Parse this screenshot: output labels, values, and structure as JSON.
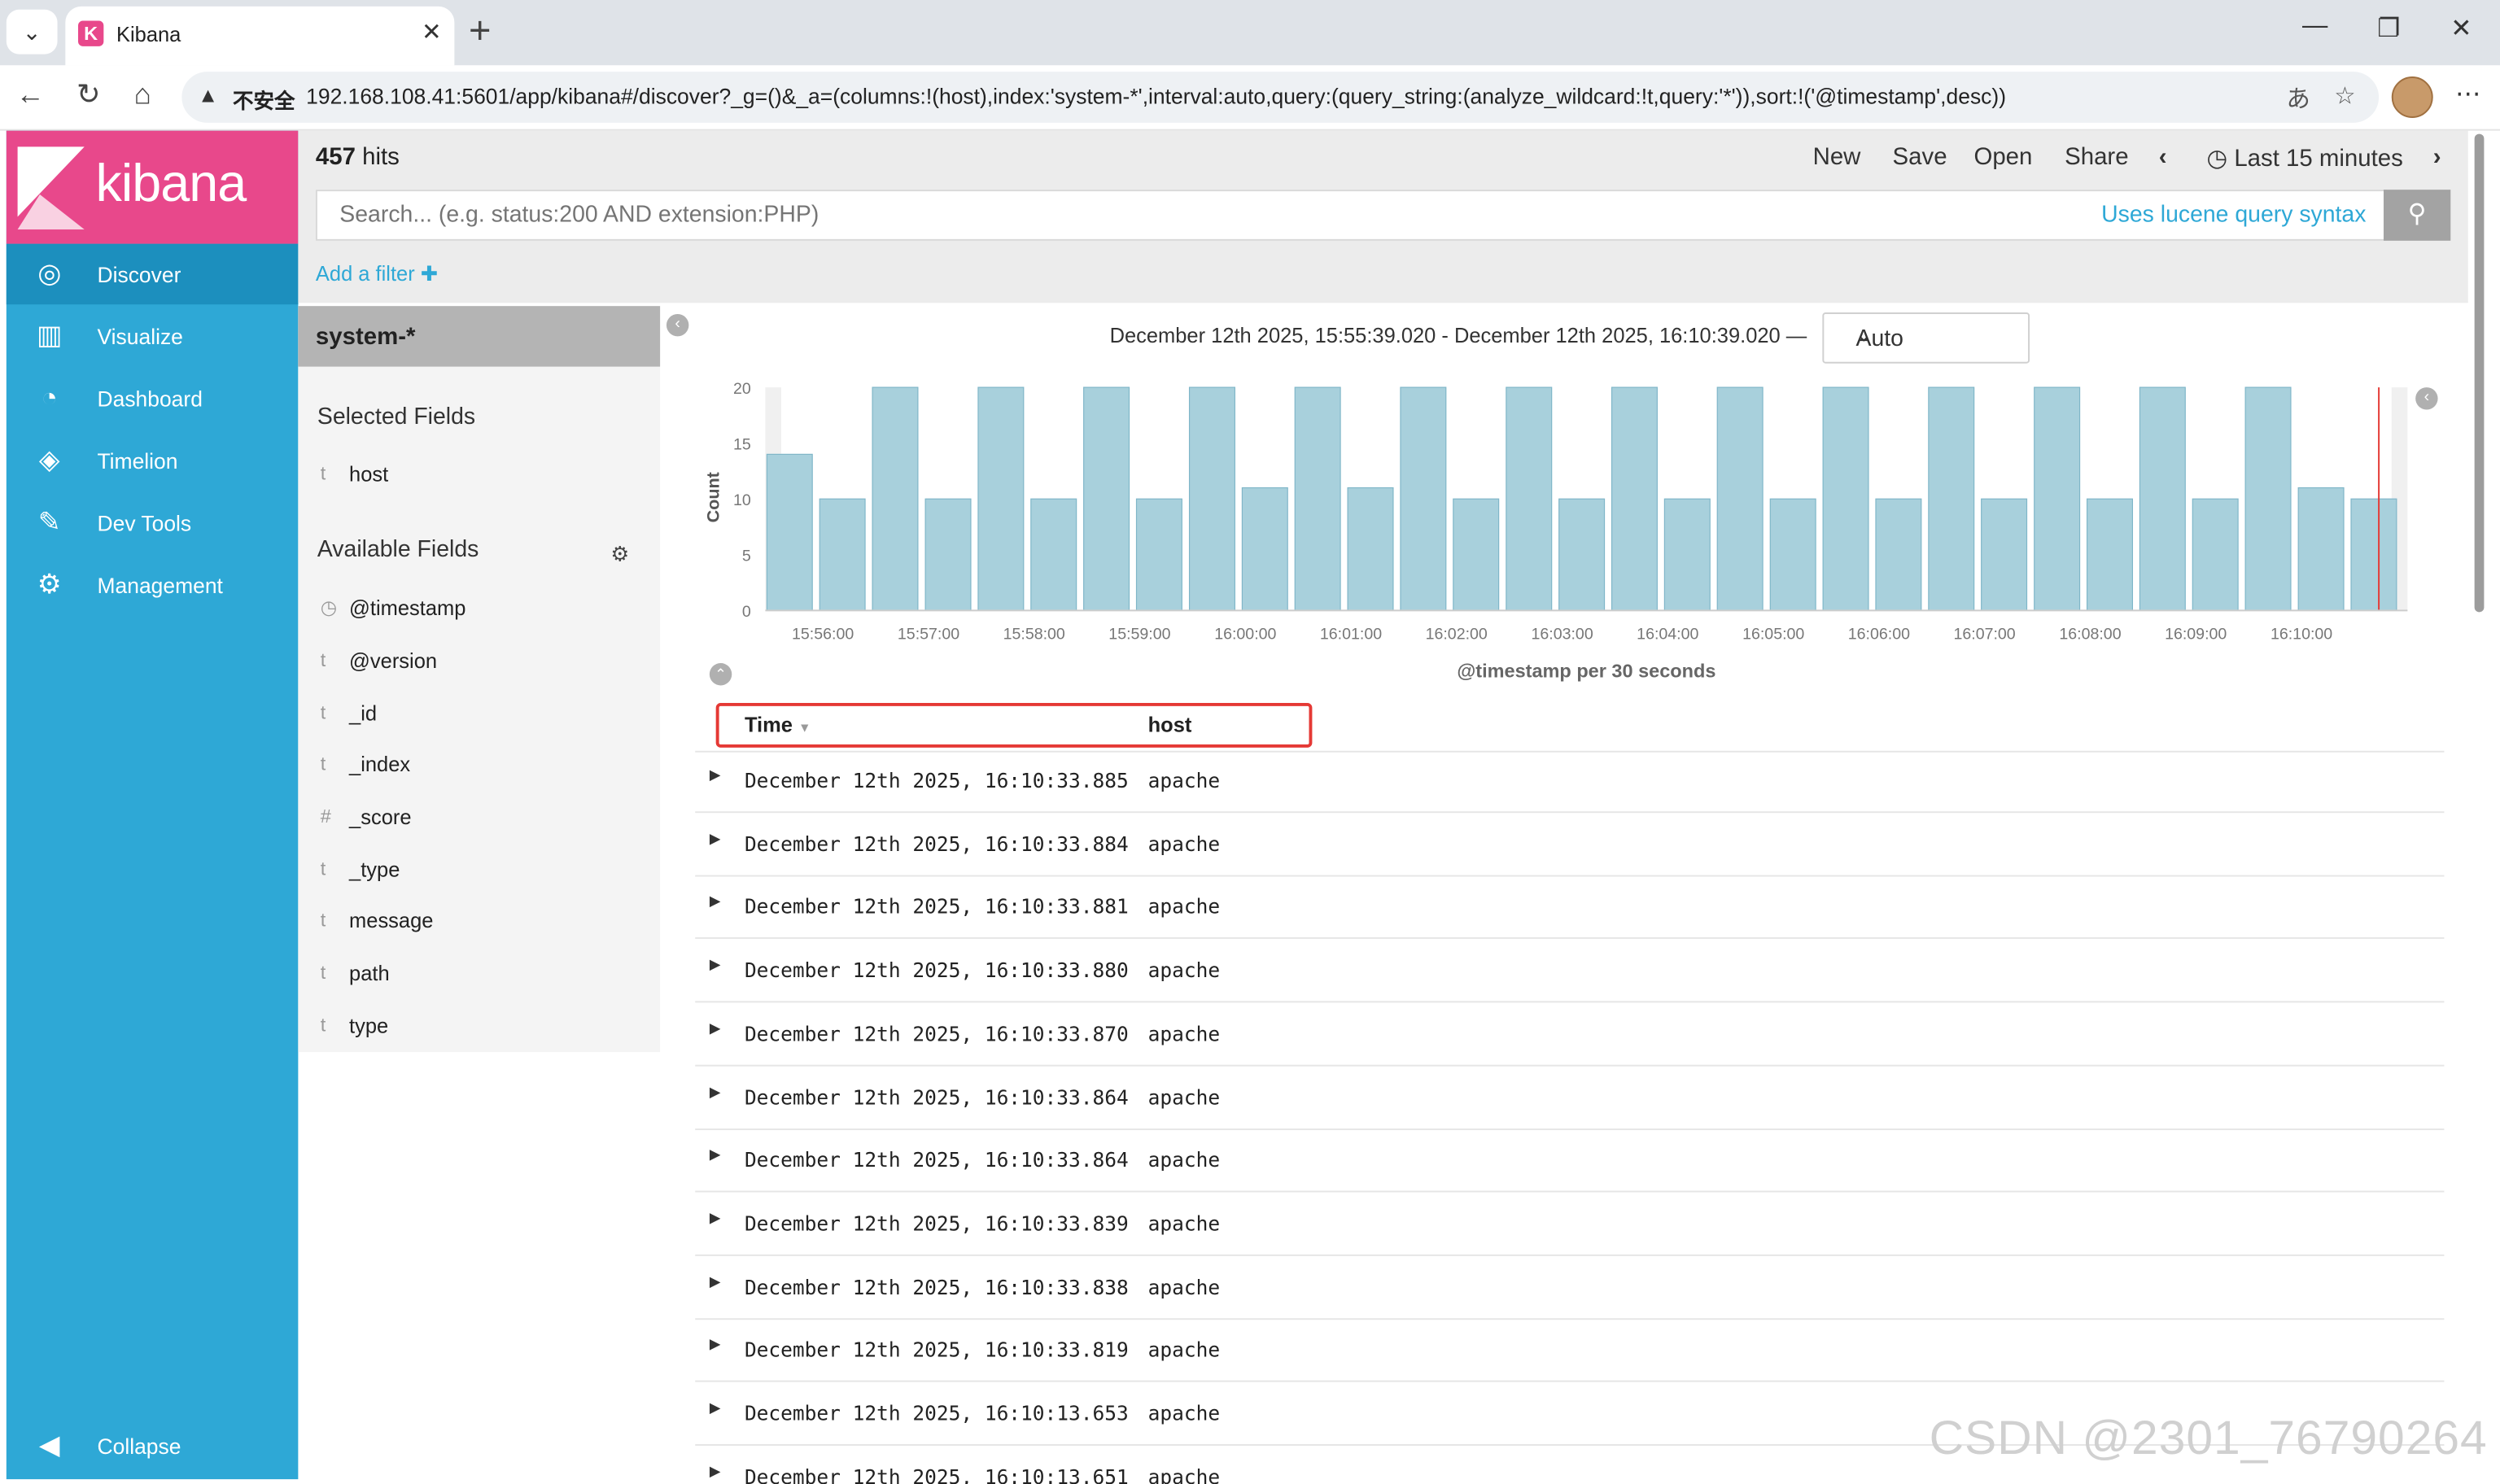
{
  "browser": {
    "tab_title": "Kibana",
    "favicon_letter": "K",
    "security_label": "不安全",
    "url": "192.168.108.41:5601/app/kibana#/discover?_g=()&_a=(columns:!(host),index:'system-*',interval:auto,query:(query_string:(analyze_wildcard:!t,query:'*')),sort:!('@timestamp',desc))"
  },
  "sidebar": {
    "logo_text": "kibana",
    "items": [
      {
        "label": "Discover",
        "icon": "compass-icon",
        "glyph": "◎"
      },
      {
        "label": "Visualize",
        "icon": "bar-chart-icon",
        "glyph": "▥"
      },
      {
        "label": "Dashboard",
        "icon": "gauge-icon",
        "glyph": "◔"
      },
      {
        "label": "Timelion",
        "icon": "timelion-icon",
        "glyph": "◈"
      },
      {
        "label": "Dev Tools",
        "icon": "wrench-icon",
        "glyph": "✎"
      },
      {
        "label": "Management",
        "icon": "gear-icon",
        "glyph": "⚙"
      }
    ],
    "collapse_label": "Collapse"
  },
  "topbar": {
    "hits_count": "457",
    "hits_suffix": "hits",
    "menu": [
      "New",
      "Save",
      "Open",
      "Share"
    ],
    "time_label": "Last 15 minutes",
    "search_placeholder": "Search... (e.g. status:200 AND extension:PHP)",
    "lucene_label": "Uses lucene query syntax",
    "add_filter_label": "Add a filter"
  },
  "fields_panel": {
    "index_pattern": "system-*",
    "selected_title": "Selected Fields",
    "selected_fields": [
      {
        "type": "t",
        "name": "host"
      }
    ],
    "available_title": "Available Fields",
    "available_fields": [
      {
        "type": "◷",
        "name": "@timestamp"
      },
      {
        "type": "t",
        "name": "@version"
      },
      {
        "type": "t",
        "name": "_id"
      },
      {
        "type": "t",
        "name": "_index"
      },
      {
        "type": "#",
        "name": "_score"
      },
      {
        "type": "t",
        "name": "_type"
      },
      {
        "type": "t",
        "name": "message"
      },
      {
        "type": "t",
        "name": "path"
      },
      {
        "type": "t",
        "name": "type"
      }
    ]
  },
  "histogram": {
    "range_text": "December 12th 2025, 15:55:39.020 - December 12th 2025, 16:10:39.020 —",
    "interval_value": "Auto"
  },
  "chart_data": {
    "type": "bar",
    "ylabel": "Count",
    "xlabel": "@timestamp per 30 seconds",
    "ylim": [
      0,
      20
    ],
    "yticks": [
      0,
      5,
      10,
      15,
      20
    ],
    "xticks": [
      "15:56:00",
      "15:57:00",
      "15:58:00",
      "15:59:00",
      "16:00:00",
      "16:01:00",
      "16:02:00",
      "16:03:00",
      "16:04:00",
      "16:05:00",
      "16:06:00",
      "16:07:00",
      "16:08:00",
      "16:09:00",
      "16:10:00"
    ],
    "values": [
      14,
      10,
      20,
      10,
      20,
      10,
      20,
      10,
      20,
      11,
      20,
      11,
      20,
      10,
      20,
      10,
      20,
      10,
      20,
      10,
      20,
      10,
      20,
      10,
      20,
      10,
      20,
      10,
      20,
      11,
      10
    ],
    "bar_color": "#a8d0dc",
    "grid": false
  },
  "table": {
    "col_time": "Time",
    "col_host": "host",
    "rows": [
      {
        "time": "December 12th 2025, 16:10:33.885",
        "host": "apache"
      },
      {
        "time": "December 12th 2025, 16:10:33.884",
        "host": "apache"
      },
      {
        "time": "December 12th 2025, 16:10:33.881",
        "host": "apache"
      },
      {
        "time": "December 12th 2025, 16:10:33.880",
        "host": "apache"
      },
      {
        "time": "December 12th 2025, 16:10:33.870",
        "host": "apache"
      },
      {
        "time": "December 12th 2025, 16:10:33.864",
        "host": "apache"
      },
      {
        "time": "December 12th 2025, 16:10:33.864",
        "host": "apache"
      },
      {
        "time": "December 12th 2025, 16:10:33.839",
        "host": "apache"
      },
      {
        "time": "December 12th 2025, 16:10:33.838",
        "host": "apache"
      },
      {
        "time": "December 12th 2025, 16:10:33.819",
        "host": "apache"
      },
      {
        "time": "December 12th 2025, 16:10:13.653",
        "host": "apache"
      },
      {
        "time": "December 12th 2025, 16:10:13.651",
        "host": "apache"
      }
    ]
  },
  "watermark": "CSDN @2301_76790264",
  "colors": {
    "brand_pink": "#e8488b",
    "sidebar_blue": "#2ea8d6",
    "link_blue": "#2ea8d6",
    "highlight_red": "#e53935"
  }
}
